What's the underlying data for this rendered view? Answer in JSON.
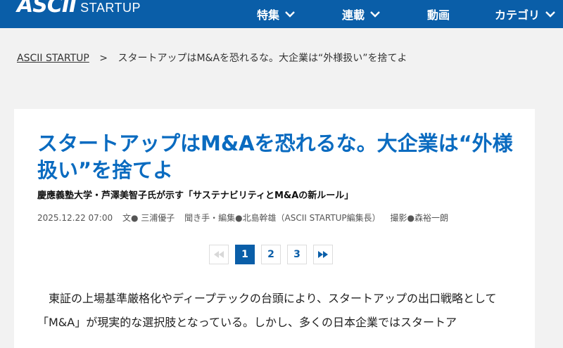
{
  "header": {
    "logo_main": "ASCII",
    "logo_sub": "STARTUP",
    "nav": [
      {
        "label": "特集",
        "has_dropdown": true
      },
      {
        "label": "連載",
        "has_dropdown": true
      },
      {
        "label": "動画",
        "has_dropdown": false
      },
      {
        "label": "カテゴリ",
        "has_dropdown": true
      }
    ],
    "colors": {
      "brand": "#0a5ea8",
      "title": "#0a6bc0"
    }
  },
  "breadcrumb": {
    "home": "ASCII STARTUP",
    "separator": ">",
    "current": "スタートアップはM&Aを恐れるな。大企業は“外様扱い”を捨てよ"
  },
  "article": {
    "title": "スタートアップはM&Aを恐れるな。大企業は“外様扱い”を捨てよ",
    "subtitle": "慶應義塾大学・芦澤美智子氏が示す「サステナビリティとM&Aの新ルール」",
    "date": "2025.12.22 07:00",
    "writer": "文● 三浦優子",
    "interviewer": "聞き手・編集●北島幹雄（ASCII STARTUP編集長）",
    "photographer": "撮影●森裕一朗",
    "pager": {
      "pages": [
        "1",
        "2",
        "3"
      ],
      "current": "1",
      "prev_icon": "double-chevron-left-icon",
      "next_icon": "double-chevron-right-icon"
    },
    "body": "東証の上場基準厳格化やディープテックの台頭により、スタートアップの出口戦略として「M&A」が現実的な選択肢となっている。しかし、多くの日本企業ではスタートア"
  }
}
